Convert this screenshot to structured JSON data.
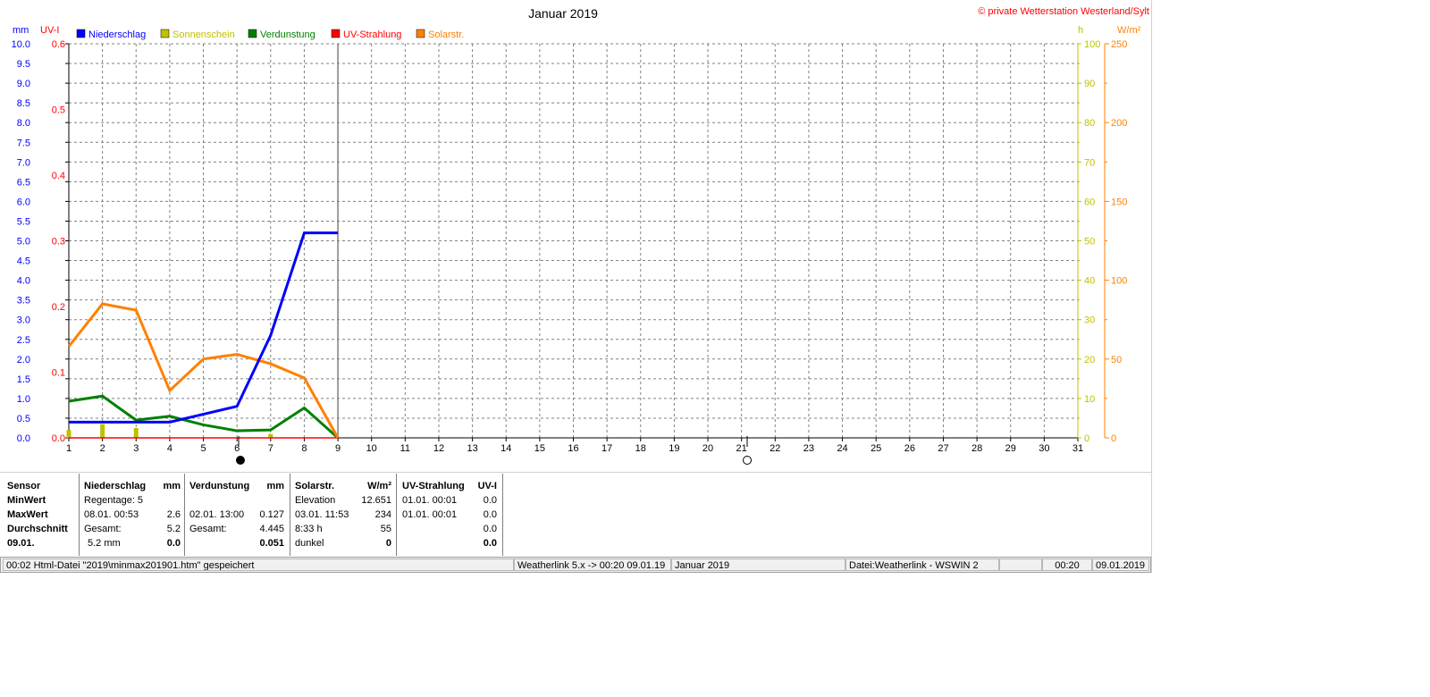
{
  "chart_data": {
    "type": "line",
    "title": "Januar 2019",
    "copyright": "© private Wetterstation Westerland/Sylt",
    "x": [
      1,
      2,
      3,
      4,
      5,
      6,
      7,
      8,
      9
    ],
    "x_ticks": [
      1,
      2,
      3,
      4,
      5,
      6,
      7,
      8,
      9,
      10,
      11,
      12,
      13,
      14,
      15,
      16,
      17,
      18,
      19,
      20,
      21,
      22,
      23,
      24,
      25,
      26,
      27,
      28,
      29,
      30,
      31
    ],
    "xlim": [
      1,
      31
    ],
    "grid": true,
    "legend_placement": "top-left",
    "axes": {
      "mm": {
        "label": "mm",
        "range": [
          0,
          10
        ],
        "ticks": [
          "0.0",
          "0.5",
          "1.0",
          "1.5",
          "2.0",
          "2.5",
          "3.0",
          "3.5",
          "4.0",
          "4.5",
          "5.0",
          "5.5",
          "6.0",
          "6.5",
          "7.0",
          "7.5",
          "8.0",
          "8.5",
          "9.0",
          "9.5",
          "10.0"
        ],
        "color": "#0000ff"
      },
      "uvi": {
        "label": "UV-I",
        "range": [
          0,
          0.6
        ],
        "ticks": [
          "0.0",
          "0.1",
          "0.2",
          "0.3",
          "0.4",
          "0.5",
          "0.6"
        ],
        "color": "#ff0000"
      },
      "h": {
        "label": "h",
        "range": [
          0,
          100
        ],
        "ticks": [
          "0",
          "10",
          "20",
          "30",
          "40",
          "50",
          "60",
          "70",
          "80",
          "90",
          "100"
        ],
        "color": "#c0c000"
      },
      "wm2": {
        "label": "W/m²",
        "range": [
          0,
          250
        ],
        "ticks": [
          "0",
          "50",
          "100",
          "150",
          "200",
          "250"
        ],
        "color": "#ff8000"
      }
    },
    "series": [
      {
        "name": "Niederschlag",
        "axis": "mm",
        "color": "#0000ff",
        "kind": "line",
        "values": [
          0.4,
          0.4,
          0.4,
          0.4,
          0.6,
          0.8,
          2.6,
          5.2,
          5.2
        ],
        "x_end": 9
      },
      {
        "name": "Sonnenschein",
        "axis": "h",
        "color": "#c0c000",
        "kind": "bar",
        "values": [
          2.0,
          3.5,
          2.5,
          0,
          0,
          0,
          1.0,
          0,
          0
        ]
      },
      {
        "name": "Verdunstung",
        "axis": "mm",
        "color": "#008000",
        "kind": "line",
        "values": [
          0.93,
          1.06,
          0.45,
          0.55,
          0.33,
          0.18,
          0.2,
          0.76,
          0.0
        ]
      },
      {
        "name": "UV-Strahlung",
        "axis": "uvi",
        "color": "#ff0000",
        "kind": "line",
        "values": [
          0,
          0,
          0,
          0,
          0,
          0,
          0,
          0,
          0
        ]
      },
      {
        "name": "Solarstr.",
        "axis": "wm2",
        "color": "#ff8000",
        "kind": "line",
        "values": [
          58,
          85,
          81,
          30,
          50,
          53,
          47,
          38,
          0
        ]
      }
    ]
  },
  "table": {
    "col0": {
      "header": "Sensor",
      "min": "MinWert",
      "max": "MaxWert",
      "avg": "Durchschnitt",
      "date": "09.01."
    },
    "col1": {
      "header": "Niederschlag",
      "unit": "mm",
      "min_a": "Regentage: 5",
      "min_b": "",
      "max_a": "08.01.  00:53",
      "max_b": "2.6",
      "avg_a": "Gesamt:",
      "avg_b": "5.2",
      "date_a": "5.2 mm",
      "date_b": "0.0"
    },
    "col2": {
      "header": "Verdunstung",
      "unit": "mm",
      "min_a": "",
      "min_b": "",
      "max_a": "02.01.  13:00",
      "max_b": "0.127",
      "avg_a": "Gesamt:",
      "avg_b": "4.445",
      "date_a": "",
      "date_b": "0.051"
    },
    "col3": {
      "header": "Solarstr.",
      "unit": "W/m²",
      "min_a": "Elevation",
      "min_b": "12.651",
      "max_a": "03.01.  11:53",
      "max_b": "234",
      "avg_a": "8:33 h",
      "avg_b": "55",
      "date_a": "dunkel",
      "date_b": "0"
    },
    "col4": {
      "header": "UV-Strahlung",
      "unit": "UV-I",
      "min_a": "01.01.  00:01",
      "min_b": "0.0",
      "max_a": "01.01.  00:01",
      "max_b": "0.0",
      "avg_a": "",
      "avg_b": "0.0",
      "date_a": "",
      "date_b": "0.0"
    }
  },
  "statusbar": {
    "left": "00:02  Html-Datei  \"2019\\minmax201901.htm\"  gespeichert",
    "weatherlink": "Weatherlink 5.x -> 00:20  09.01.19",
    "month": "Januar 2019",
    "file": "Datei:Weatherlink - WSWIN 2",
    "empty": "",
    "time": "00:20",
    "date": "09.01.2019"
  }
}
